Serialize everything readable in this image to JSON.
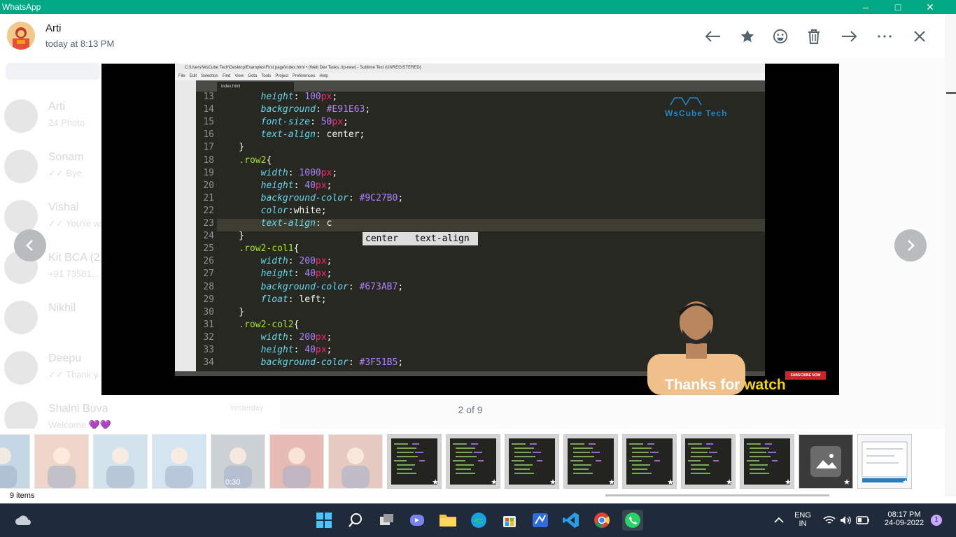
{
  "window": {
    "title": "WhatsApp",
    "accent": "#00a884"
  },
  "sender": {
    "name": "Arti",
    "time": "today at 8:13 PM"
  },
  "header_actions": [
    "arrow-left-icon",
    "star-icon",
    "emoji-icon",
    "trash-icon",
    "arrow-right-icon",
    "more-icon",
    "close-icon"
  ],
  "background_chats": [
    {
      "name": "Arti",
      "preview": "24 Photo"
    },
    {
      "name": "Sonam",
      "preview": "✓✓ Bye"
    },
    {
      "name": "Vishal",
      "preview": "✓✓ You're w..."
    },
    {
      "name": "Kit BCA (2...",
      "preview": "+91 73581..."
    },
    {
      "name": "Nikhil",
      "preview": ""
    },
    {
      "name": "Deepu",
      "preview": "✓✓ Thank y..."
    },
    {
      "name": "Shalni Buva",
      "preview": "Welcome 💜💜",
      "time": "Yesterday"
    }
  ],
  "media": {
    "editor_title": "C:\\Users\\WsCube Tech\\Desktop\\Examples\\First page\\index.html • (Web Dev Tasks, tip-new) - Sublime Text (UNREGISTERED)",
    "menu": [
      "File",
      "Edit",
      "Selection",
      "Find",
      "View",
      "Goto",
      "Tools",
      "Project",
      "Preferences",
      "Help"
    ],
    "tab": "index.html",
    "code_lines": [
      {
        "n": "13",
        "t": "        height: 100px;"
      },
      {
        "n": "14",
        "t": "        background: #E91E63;"
      },
      {
        "n": "15",
        "t": "        font-size: 50px;"
      },
      {
        "n": "16",
        "t": "        text-align: center;"
      },
      {
        "n": "17",
        "t": "    }"
      },
      {
        "n": "18",
        "t": "    .row2{"
      },
      {
        "n": "19",
        "t": "        width: 1000px;"
      },
      {
        "n": "20",
        "t": "        height: 40px;"
      },
      {
        "n": "21",
        "t": "        background-color: #9C27B0;"
      },
      {
        "n": "22",
        "t": "        color:white;"
      },
      {
        "n": "23",
        "t": "        text-align: c"
      },
      {
        "n": "24",
        "t": "    }"
      },
      {
        "n": "25",
        "t": "    .row2-col1{"
      },
      {
        "n": "26",
        "t": "        width: 200px;"
      },
      {
        "n": "27",
        "t": "        height: 40px;"
      },
      {
        "n": "28",
        "t": "        background-color: #673AB7;"
      },
      {
        "n": "29",
        "t": "        float: left;"
      },
      {
        "n": "30",
        "t": "    }"
      },
      {
        "n": "31",
        "t": "    .row2-col2{"
      },
      {
        "n": "32",
        "t": "        width: 200px;"
      },
      {
        "n": "33",
        "t": "        height: 40px;"
      },
      {
        "n": "34",
        "t": "        background-color: #3F51B5;"
      }
    ],
    "autocomplete": "center   text-align",
    "brand": "WsCube Tech",
    "thanks_prefix": "Thanks for ",
    "thanks_highlight": "watch",
    "subscribe": "SUBSCRIBE NOW"
  },
  "counter": "2 of 9",
  "thumbnails": [
    {
      "kind": "photo",
      "faded": true
    },
    {
      "kind": "photo",
      "faded": true
    },
    {
      "kind": "photo",
      "faded": true
    },
    {
      "kind": "photo",
      "faded": true
    },
    {
      "kind": "video",
      "faded": true,
      "duration": "0:30"
    },
    {
      "kind": "photo",
      "faded": true
    },
    {
      "kind": "photo",
      "faded": true
    },
    {
      "kind": "code",
      "faded": false,
      "starred": true
    },
    {
      "kind": "code",
      "faded": false,
      "starred": true
    },
    {
      "kind": "code",
      "faded": false,
      "starred": true
    },
    {
      "kind": "code",
      "faded": false,
      "starred": true
    },
    {
      "kind": "code",
      "faded": false,
      "starred": true
    },
    {
      "kind": "code",
      "faded": false,
      "starred": true
    },
    {
      "kind": "code",
      "faded": false,
      "starred": true
    },
    {
      "kind": "image-placeholder",
      "faded": false,
      "starred": true
    },
    {
      "kind": "doc",
      "faded": false,
      "starred": true
    }
  ],
  "items_count": "9 items",
  "taskbar": {
    "lang_top": "ENG",
    "lang_bottom": "IN",
    "time": "08:17 PM",
    "date": "24-09-2022",
    "notifications": "1"
  }
}
